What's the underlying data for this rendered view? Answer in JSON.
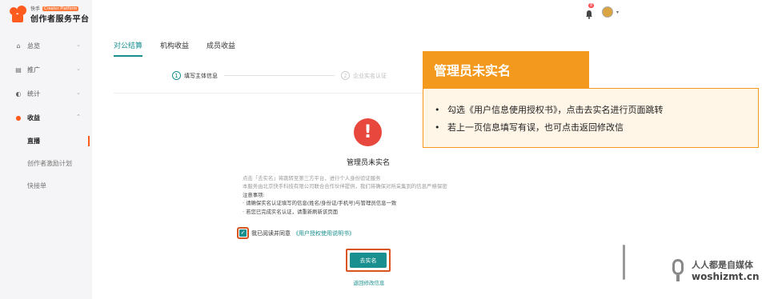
{
  "logo": {
    "brand_small": "快手",
    "badge": "Creator Platform",
    "title": "创作者服务平台"
  },
  "sidebar": {
    "items": [
      {
        "label": "总览",
        "icon": "home-icon"
      },
      {
        "label": "推广",
        "icon": "promote-icon"
      },
      {
        "label": "统计",
        "icon": "stats-icon"
      },
      {
        "label": "收益",
        "icon": "revenue-icon"
      }
    ],
    "sub_items": [
      {
        "label": "直播"
      },
      {
        "label": "创作者激励计划"
      },
      {
        "label": "快接单"
      }
    ]
  },
  "header": {
    "notification_count": "8"
  },
  "tabs": [
    {
      "label": "对公结算"
    },
    {
      "label": "机构收益"
    },
    {
      "label": "成员收益"
    }
  ],
  "steps": [
    {
      "num": "1",
      "label": "填写主体信息"
    },
    {
      "num": "2",
      "label": "企业实名认证"
    }
  ],
  "main": {
    "title": "管理员未实名",
    "desc_line1": "点击「去实名」将跳转至第三方平台，进行个人身份验证服务",
    "desc_line2": "本服务由北京快手科技有限公司联合合作伙伴提供，我们将确保对所采集到的信息严格保密",
    "notice_title": "注意事项:",
    "notice_1": "· 请确保实名认证填写的信息(姓名/身份证/手机号)与管理员信息一致",
    "notice_2": "· 若您已完成实名认证，请重新刷新该页面",
    "agree_text": "我已阅读并同意",
    "agree_link": "《用户授权使用说明书》",
    "cta_label": "去实名",
    "back_label": "返回修改信息"
  },
  "callout": {
    "title": "管理员未实名",
    "bullets": [
      "勾选《用户信息使用授权书》，点击去实名进行页面跳转",
      "若上一页信息填写有误，也可点击返回修改信"
    ]
  },
  "watermark": {
    "cn": "人人都是自媒体",
    "en": "woshizmt.cn"
  },
  "colors": {
    "accent": "#1a8f8f",
    "brand": "#ff5b1f",
    "callout": "#f39a1e",
    "alert": "#e8473e"
  }
}
